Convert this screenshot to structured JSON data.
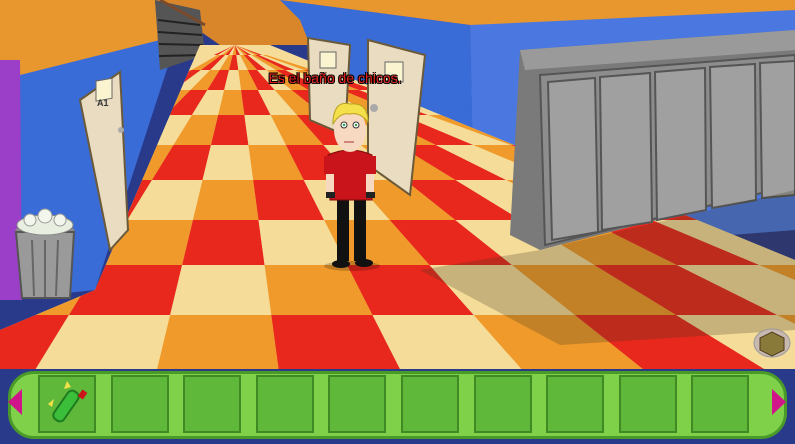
{
  "dialogue": {
    "text": "Es el baño de chicos."
  },
  "doors": {
    "classroom_label": "A1"
  },
  "inventory": {
    "slot_count": 10,
    "items": [
      "green-bottle"
    ]
  },
  "colors": {
    "floor_red": "#e8281c",
    "floor_orange": "#ef9a2a",
    "floor_cream": "#f5dc98",
    "wall_blue": "#3a6cd8",
    "inventory_green": "#7fd14a",
    "arrow_magenta": "#d0148a"
  }
}
